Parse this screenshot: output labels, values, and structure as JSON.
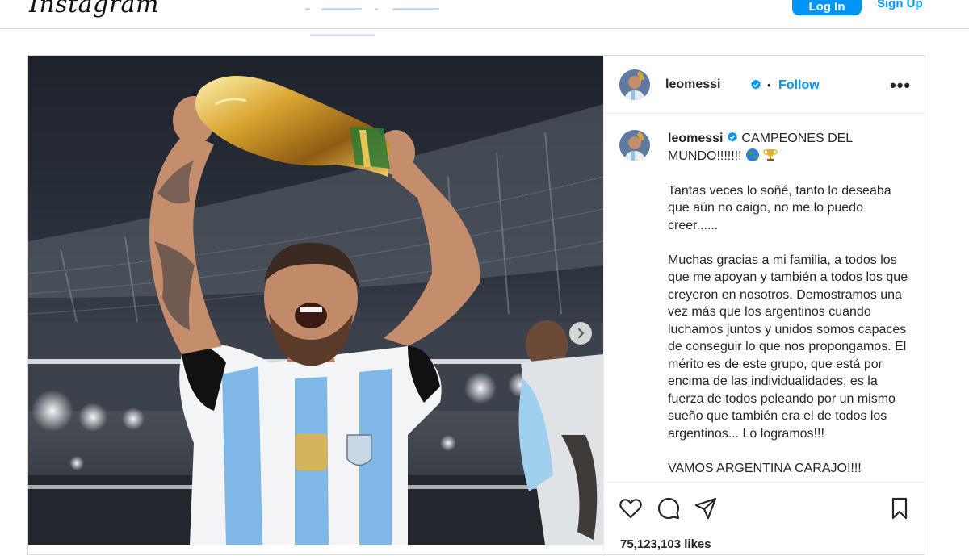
{
  "nav": {
    "logo": "Instagram",
    "login_label": "Log In",
    "signup_label": "Sign Up"
  },
  "post": {
    "author": "leomessi",
    "follow_label": "Follow",
    "separator": "•",
    "more_label": "•••",
    "caption_title": "CAMPEONES DEL MUNDO!!!!!!!",
    "caption_paragraphs": [
      "Tantas veces lo soñé, tanto lo deseaba que aún no caigo, no me lo puedo creer......",
      "Muchas gracias a mi familia, a todos los que me apoyan y también a todos los que creyeron en nosotros. Demostramos una vez más que los argentinos cuando luchamos juntos y unidos somos capaces de conseguir lo que nos propongamos. El mérito es de este grupo, que está por encima de las individualidades, es la fuerza de todos peleando por un mismo sueño que también era el de todos los argentinos... Lo logramos!!!"
    ],
    "caption_cutoff": "VAMOS ARGENTINA CARAJO!!!!",
    "likes": "75,123,103 likes"
  },
  "icons": {
    "verified": "verified-badge-icon",
    "like": "heart-icon",
    "comment": "comment-icon",
    "share": "send-icon",
    "save": "bookmark-icon",
    "next": "chevron-right-icon",
    "more": "more-options-icon",
    "globe": "globe-emoji-icon",
    "trophy": "trophy-emoji-icon"
  },
  "colors": {
    "accent": "#0095f6",
    "border": "#dbdbdb",
    "text": "#262626"
  }
}
